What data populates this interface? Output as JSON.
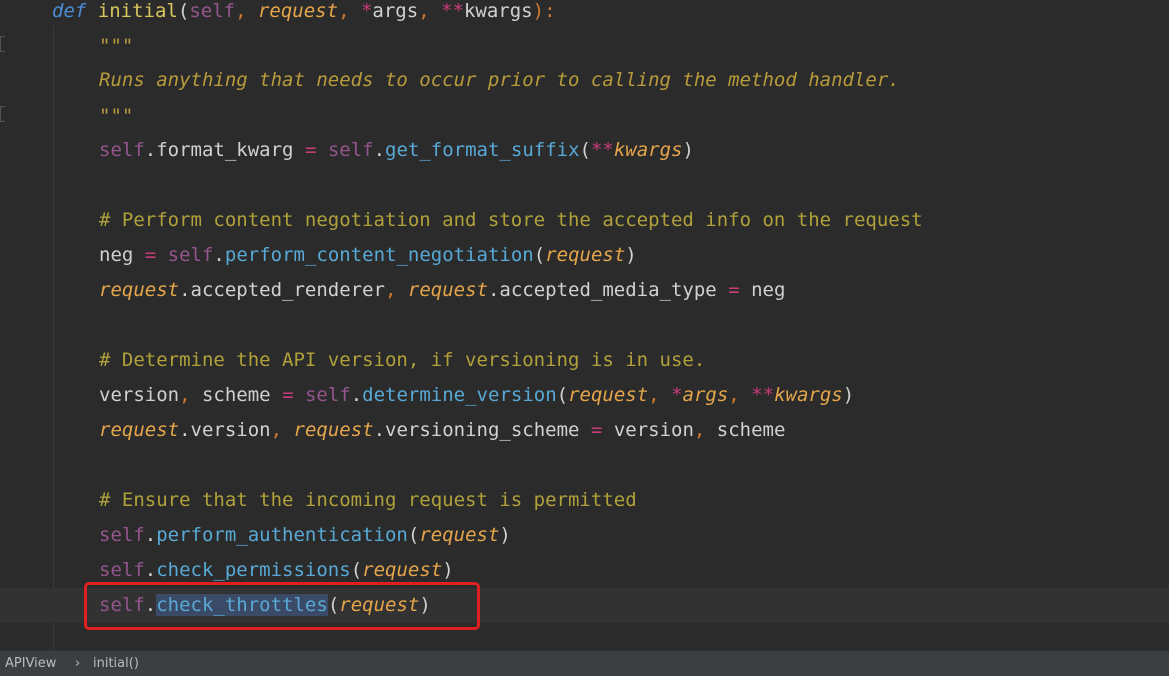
{
  "breadcrumb": {
    "class_name": "APIView",
    "separator": "›",
    "method_name": "initial()"
  },
  "code": {
    "l1": {
      "def": "def",
      "name": "initial",
      "open": "(",
      "self": "self",
      "c1": ",",
      "request": "request",
      "c2": ",",
      "star": "*",
      "args": "args",
      "c3": ",",
      "dstar": "**",
      "kwargs": "kwargs",
      "close": "):"
    },
    "l2": {
      "quote": "\"\"\""
    },
    "l3": {
      "text": "Runs anything that needs to occur prior to calling the method handler."
    },
    "l4": {
      "quote": "\"\"\""
    },
    "l5": {
      "self1": "self",
      "dot1": ".",
      "attr": "format_kwarg",
      "eq": " = ",
      "self2": "self",
      "dot2": ".",
      "call": "get_format_suffix",
      "open": "(",
      "dstar": "**",
      "kwargs": "kwargs",
      "close": ")"
    },
    "l7": {
      "text": "# Perform content negotiation and store the accepted info on the request"
    },
    "l8": {
      "var": "neg",
      "eq": " = ",
      "self": "self",
      "dot": ".",
      "call": "perform_content_negotiation",
      "open": "(",
      "request": "request",
      "close": ")"
    },
    "l9": {
      "req1": "request",
      "attr1": ".accepted_renderer",
      "comma": ",",
      "req2": "request",
      "attr2": ".accepted_media_type",
      "eq": " = ",
      "var": "neg"
    },
    "l11": {
      "text": "# Determine the API version, if versioning is in use."
    },
    "l12": {
      "v1": "version",
      "comma1": ",",
      "v2": "scheme",
      "eq": " = ",
      "self": "self",
      "dot": ".",
      "call": "determine_version",
      "open": "(",
      "request": "request",
      "comma2": ",",
      "star": "*",
      "args": "args",
      "comma3": ",",
      "dstar": "**",
      "kwargs": "kwargs",
      "close": ")"
    },
    "l13": {
      "req1": "request",
      "attr1": ".version",
      "comma1": ",",
      "req2": "request",
      "attr2": ".versioning_scheme",
      "eq": " = ",
      "v1": "version",
      "comma2": ",",
      "v2": "scheme"
    },
    "l15": {
      "text": "# Ensure that the incoming request is permitted"
    },
    "l16": {
      "self": "self",
      "dot": ".",
      "call": "perform_authentication",
      "open": "(",
      "request": "request",
      "close": ")"
    },
    "l17": {
      "self": "self",
      "dot": ".",
      "call": "check_permissions",
      "open": "(",
      "request": "request",
      "close": ")"
    },
    "l18": {
      "self": "self",
      "dot": ".",
      "call": "check_throttles",
      "open": "(",
      "request": "request",
      "close": ")"
    }
  },
  "colors": {
    "background": "#2b2b2b",
    "annotation": "#e02020",
    "keyword": "#4a8cd6",
    "self": "#94558d",
    "parameter": "#e5a54a",
    "comment": "#b0a13a"
  }
}
